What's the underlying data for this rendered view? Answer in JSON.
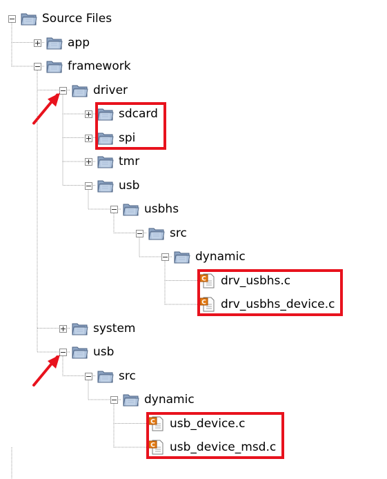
{
  "tree": [
    {
      "label": "Source Files",
      "type": "folder",
      "depth": 0,
      "toggle": "minus"
    },
    {
      "label": "app",
      "type": "folder",
      "depth": 1,
      "toggle": "plus"
    },
    {
      "label": "framework",
      "type": "folder",
      "depth": 1,
      "toggle": "minus"
    },
    {
      "label": "driver",
      "type": "folder",
      "depth": 2,
      "toggle": "minus"
    },
    {
      "label": "sdcard",
      "type": "folder",
      "depth": 3,
      "toggle": "plus"
    },
    {
      "label": "spi",
      "type": "folder",
      "depth": 3,
      "toggle": "plus"
    },
    {
      "label": "tmr",
      "type": "folder",
      "depth": 3,
      "toggle": "plus"
    },
    {
      "label": "usb",
      "type": "folder",
      "depth": 3,
      "toggle": "minus"
    },
    {
      "label": "usbhs",
      "type": "folder",
      "depth": 4,
      "toggle": "minus"
    },
    {
      "label": "src",
      "type": "folder",
      "depth": 5,
      "toggle": "minus"
    },
    {
      "label": "dynamic",
      "type": "folder",
      "depth": 6,
      "toggle": "minus"
    },
    {
      "label": "drv_usbhs.c",
      "type": "file",
      "depth": 7,
      "toggle": "none"
    },
    {
      "label": "drv_usbhs_device.c",
      "type": "file",
      "depth": 7,
      "toggle": "none"
    },
    {
      "label": "system",
      "type": "folder",
      "depth": 2,
      "toggle": "plus"
    },
    {
      "label": "usb",
      "type": "folder",
      "depth": 2,
      "toggle": "minus"
    },
    {
      "label": "src",
      "type": "folder",
      "depth": 3,
      "toggle": "minus"
    },
    {
      "label": "dynamic",
      "type": "folder",
      "depth": 4,
      "toggle": "minus"
    },
    {
      "label": "usb_device.c",
      "type": "file",
      "depth": 5,
      "toggle": "none"
    },
    {
      "label": "usb_device_msd.c",
      "type": "file",
      "depth": 5,
      "toggle": "none"
    }
  ],
  "annotations": {
    "highlight_color": "#e8121d",
    "highlights": [
      {
        "name": "highlight-driver-folders",
        "items": [
          "sdcard",
          "spi"
        ]
      },
      {
        "name": "highlight-usbhs-files",
        "items": [
          "drv_usbhs.c",
          "drv_usbhs_device.c"
        ]
      },
      {
        "name": "highlight-usb-device-files",
        "items": [
          "usb_device.c",
          "usb_device_msd.c"
        ]
      }
    ],
    "arrows": [
      {
        "name": "arrow-to-driver-toggle",
        "target": "driver"
      },
      {
        "name": "arrow-to-usb-toggle",
        "target": "usb"
      }
    ]
  },
  "icons": {
    "folder": "folder-icon",
    "file": "c-source-file-icon"
  }
}
